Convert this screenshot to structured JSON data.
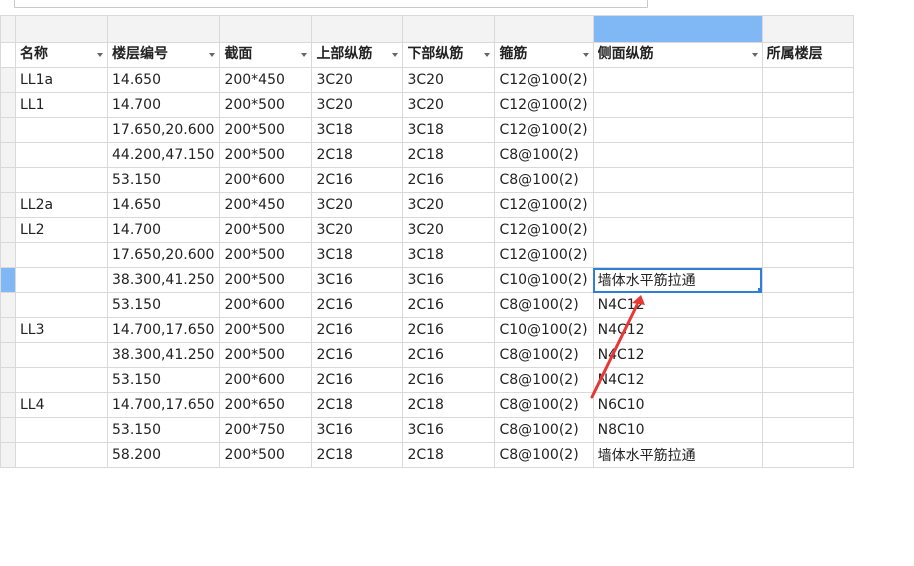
{
  "formula_bar": {
    "value": ""
  },
  "columns": [
    {
      "label": "名称"
    },
    {
      "label": "楼层编号"
    },
    {
      "label": "截面"
    },
    {
      "label": "上部纵筋"
    },
    {
      "label": "下部纵筋"
    },
    {
      "label": "箍筋"
    },
    {
      "label": "侧面纵筋"
    },
    {
      "label": "所属楼层"
    }
  ],
  "rows": [
    [
      "LL1a",
      "14.650",
      "200*450",
      "3C20",
      "3C20",
      "C12@100(2)",
      "",
      ""
    ],
    [
      "LL1",
      "14.700",
      "200*500",
      "3C20",
      "3C20",
      "C12@100(2)",
      "",
      ""
    ],
    [
      "",
      "17.650,20.600",
      "200*500",
      "3C18",
      "3C18",
      "C12@100(2)",
      "",
      ""
    ],
    [
      "",
      "44.200,47.150",
      "200*500",
      "2C18",
      "2C18",
      "C8@100(2)",
      "",
      ""
    ],
    [
      "",
      "53.150",
      "200*600",
      "2C16",
      "2C16",
      "C8@100(2)",
      "",
      ""
    ],
    [
      "LL2a",
      "14.650",
      "200*450",
      "3C20",
      "3C20",
      "C12@100(2)",
      "",
      ""
    ],
    [
      "LL2",
      "14.700",
      "200*500",
      "3C20",
      "3C20",
      "C12@100(2)",
      "",
      ""
    ],
    [
      "",
      "17.650,20.600",
      "200*500",
      "3C18",
      "3C18",
      "C12@100(2)",
      "",
      ""
    ],
    [
      "",
      "38.300,41.250",
      "200*500",
      "3C16",
      "3C16",
      "C10@100(2)",
      "墙体水平筋拉通",
      ""
    ],
    [
      "",
      "53.150",
      "200*600",
      "2C16",
      "2C16",
      "C8@100(2)",
      "N4C12",
      ""
    ],
    [
      "LL3",
      "14.700,17.650",
      "200*500",
      "2C16",
      "2C16",
      "C10@100(2)",
      "N4C12",
      ""
    ],
    [
      "",
      "38.300,41.250",
      "200*500",
      "2C16",
      "2C16",
      "C8@100(2)",
      "N4C12",
      ""
    ],
    [
      "",
      "53.150",
      "200*600",
      "2C16",
      "2C16",
      "C8@100(2)",
      "N4C12",
      ""
    ],
    [
      "LL4",
      "14.700,17.650",
      "200*650",
      "2C18",
      "2C18",
      "C8@100(2)",
      "N6C10",
      ""
    ],
    [
      "",
      "53.150",
      "200*750",
      "3C16",
      "3C16",
      "C8@100(2)",
      "N8C10",
      ""
    ],
    [
      "",
      "58.200",
      "200*500",
      "2C18",
      "2C18",
      "C8@100(2)",
      "墙体水平筋拉通",
      ""
    ]
  ],
  "colors": {
    "selection_fill": "#7fb8f5",
    "active_border": "#2f7fd8",
    "annotation_arrow": "#e53935"
  },
  "icons": {
    "filter": "dropdown-filter-icon",
    "annotation": "red-arrow-annotation"
  }
}
